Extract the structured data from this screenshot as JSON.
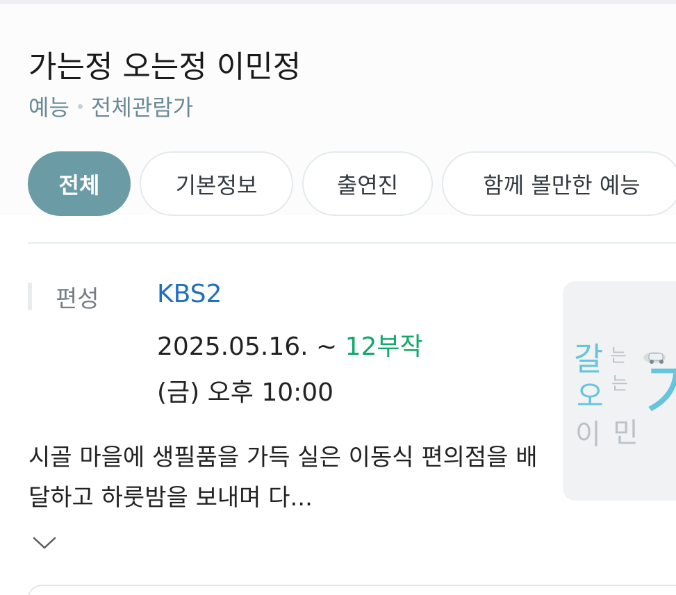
{
  "program": {
    "title": "가는정 오는정 이민정",
    "genre": "예능",
    "rating": "전체관람가"
  },
  "tabs": [
    {
      "label": "전체",
      "active": true
    },
    {
      "label": "기본정보",
      "active": false
    },
    {
      "label": "출연진",
      "active": false
    },
    {
      "label": "함께 볼만한 예능",
      "active": false
    }
  ],
  "broadcast": {
    "label": "편성",
    "network": "KBS2",
    "period": "2025.05.16. ~ ",
    "episodes": "12부작",
    "airtime": "(금) 오후 10:00"
  },
  "description": "시골 마을에 생필품을 가득 실은 이동식 편의점을 배달하고 하룻밤을 보내며 다...",
  "poster": {
    "logo_text": "갈 오 는 는 이 민 가",
    "colors": {
      "accent": "#67c4dd",
      "text": "#a9b3b8"
    }
  },
  "icons": {
    "expand": "chevron-down-icon",
    "separator": "dot-separator-icon"
  },
  "colors": {
    "accent": "#6b9ca6",
    "link": "#1f6fc1",
    "episodes": "#12a86a",
    "meta": "#6b8a98"
  }
}
